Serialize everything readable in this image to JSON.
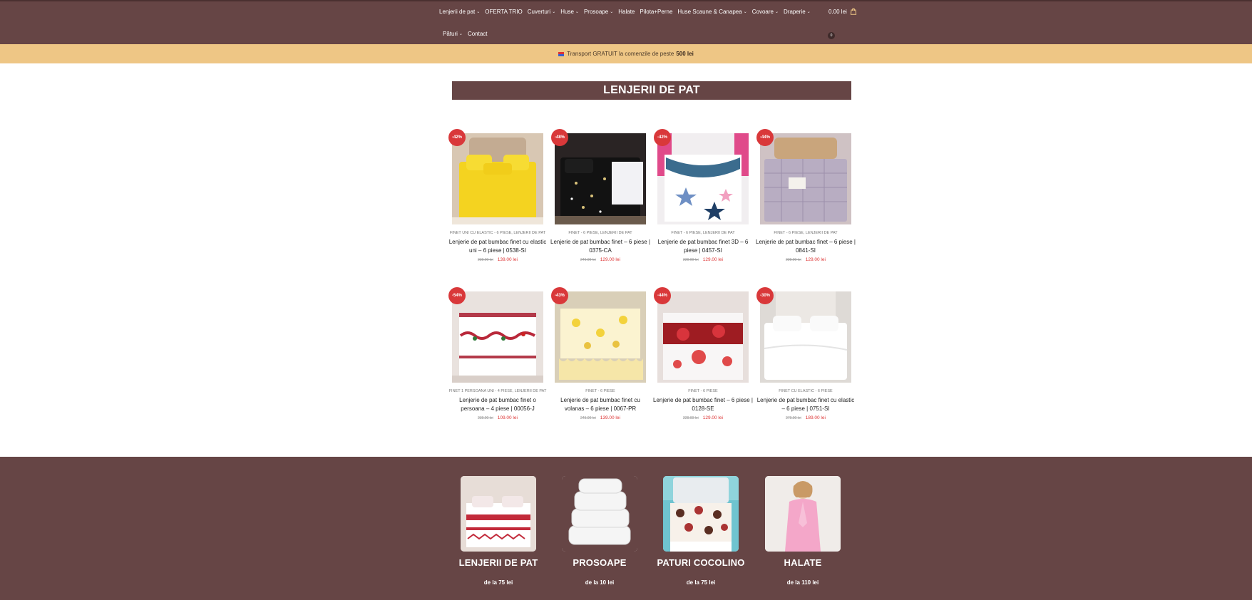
{
  "nav": {
    "items_row1": [
      {
        "label": "Lenjerii de pat",
        "dropdown": true
      },
      {
        "label": "OFERTA TRIO",
        "dropdown": false
      },
      {
        "label": "Cuverturi",
        "dropdown": true
      },
      {
        "label": "Huse",
        "dropdown": true
      },
      {
        "label": "Prosoape",
        "dropdown": true
      },
      {
        "label": "Halate",
        "dropdown": false
      },
      {
        "label": "Pilota+Perne",
        "dropdown": false
      },
      {
        "label": "Huse Scaune & Canapea",
        "dropdown": true
      },
      {
        "label": "Covoare",
        "dropdown": true
      },
      {
        "label": "Draperie",
        "dropdown": true
      }
    ],
    "items_row2": [
      {
        "label": "Pături",
        "dropdown": true
      },
      {
        "label": "Contact",
        "dropdown": false
      }
    ],
    "cart_total": "0.00 lei",
    "cart_count": "0"
  },
  "promo": {
    "text": "Transport GRATUIT la comenzile de peste",
    "amount": "500 lei"
  },
  "page_title": "LENJERII DE PAT",
  "products": [
    {
      "badge": "-42%",
      "categories": "FINET UNI CU ELASTIC - 6 PIESE, LENJERII DE PAT",
      "name": "Lenjerie de pat bumbac finet cu elastic uni – 6 piese | 0538-SI",
      "old_price": "239.00 lei",
      "price": "139.00 lei",
      "image": "yellow-bedding"
    },
    {
      "badge": "-48%",
      "categories": "FINET - 6 PIESE, LENJERII DE PAT",
      "name": "Lenjerie de pat bumbac finet – 6 piese | 0375-CA",
      "old_price": "249.00 lei",
      "price": "129.00 lei",
      "image": "black-stars-bedding"
    },
    {
      "badge": "-42%",
      "categories": "FINET - 6 PIESE, LENJERII DE PAT",
      "name": "Lenjerie de pat bumbac finet 3D – 6 piese | 0457-SI",
      "old_price": "220.00 lei",
      "price": "129.00 lei",
      "image": "stars-3d-bedding"
    },
    {
      "badge": "-44%",
      "categories": "FINET - 6 PIESE, LENJERII DE PAT",
      "name": "Lenjerie de pat bumbac finet – 6 piese | 0841-SI",
      "old_price": "229.00 lei",
      "price": "129.00 lei",
      "image": "lilac-check-bedding"
    },
    {
      "badge": "-54%",
      "categories": "FINET 1 PERSOANA UNI - 4 PIESE, LENJERII DE PAT",
      "name": "Lenjerie de pat bumbac finet o persoana – 4 piese | 00056-J",
      "old_price": "239.00 lei",
      "price": "109.00 lei",
      "image": "folk-red-bedding"
    },
    {
      "badge": "-43%",
      "categories": "FINET - 6 PIESE",
      "name": "Lenjerie de pat bumbac finet cu volanas – 6 piese | 0067-PR",
      "old_price": "245.00 lei",
      "price": "139.00 lei",
      "image": "yellow-floral-ruffle-bedding"
    },
    {
      "badge": "-44%",
      "categories": "FINET - 6 PIESE",
      "name": "Lenjerie de pat bumbac finet – 6 piese | 0128-SE",
      "old_price": "229.00 lei",
      "price": "129.00 lei",
      "image": "red-roses-bedding"
    },
    {
      "badge": "-30%",
      "categories": "FINET CU ELASTIC - 6 PIESE",
      "name": "Lenjerie de pat bumbac finet cu elastic – 6 piese | 0751-SI",
      "old_price": "279.00 lei",
      "price": "189.00 lei",
      "image": "white-bedding"
    }
  ],
  "footer_categories": [
    {
      "label": "LENJERII DE PAT",
      "price": "de la 75 lei",
      "image": "folk-pattern-bed"
    },
    {
      "label": "PROSOAPE",
      "price": "de la 10 lei",
      "image": "white-towel-stack"
    },
    {
      "label": "PATURI COCOLINO",
      "price": "de la 75 lei",
      "image": "polka-dot-bed"
    },
    {
      "label": "HALATE",
      "price": "de la 110 lei",
      "image": "pink-robe"
    }
  ],
  "colors": {
    "brand": "#664545",
    "promo": "#eec685",
    "sale": "#d9383a"
  }
}
